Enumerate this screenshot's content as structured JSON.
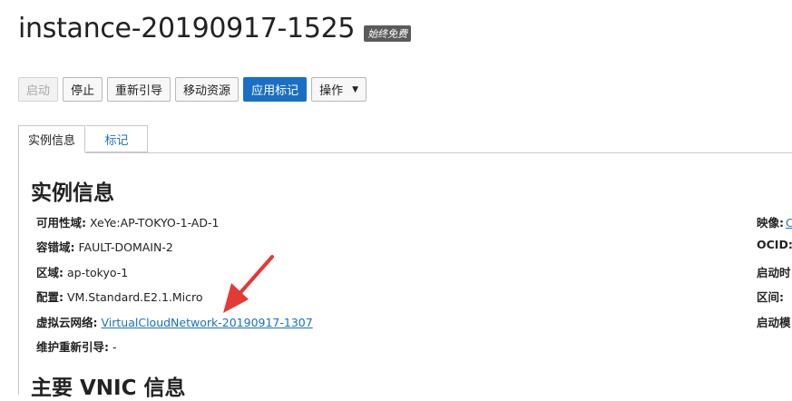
{
  "header": {
    "title": "instance-20190917-1525",
    "badge": "始终免费"
  },
  "toolbar": {
    "start_label": "启动",
    "stop_label": "停止",
    "reboot_label": "重新引导",
    "move_label": "移动资源",
    "apply_tags_label": "应用标记",
    "actions_label": "操作"
  },
  "tabs": {
    "instance_info": "实例信息",
    "tags": "标记"
  },
  "instance_info": {
    "heading": "实例信息",
    "availability_domain": {
      "label": "可用性域:",
      "value": "XeYe:AP-TOKYO-1-AD-1"
    },
    "fault_domain": {
      "label": "容错域:",
      "value": "FAULT-DOMAIN-2"
    },
    "region": {
      "label": "区域:",
      "value": "ap-tokyo-1"
    },
    "shape": {
      "label": "配置:",
      "value": "VM.Standard.E2.1.Micro"
    },
    "vcn": {
      "label": "虚拟云网络:",
      "value": "VirtualCloudNetwork-20190917-1307"
    },
    "maintenance_reboot": {
      "label": "维护重新引导:",
      "value": "-"
    }
  },
  "right_column": {
    "image": {
      "label": "映像:",
      "value": "C"
    },
    "ocid": {
      "label": "OCID:"
    },
    "launch_time": {
      "label": "启动时"
    },
    "compartment": {
      "label": "区间:"
    },
    "launch_mode": {
      "label": "启动模"
    }
  },
  "vnic": {
    "heading": "主要 VNIC 信息"
  },
  "colors": {
    "primary": "#1a6fc4",
    "arrow": "#e53935"
  }
}
